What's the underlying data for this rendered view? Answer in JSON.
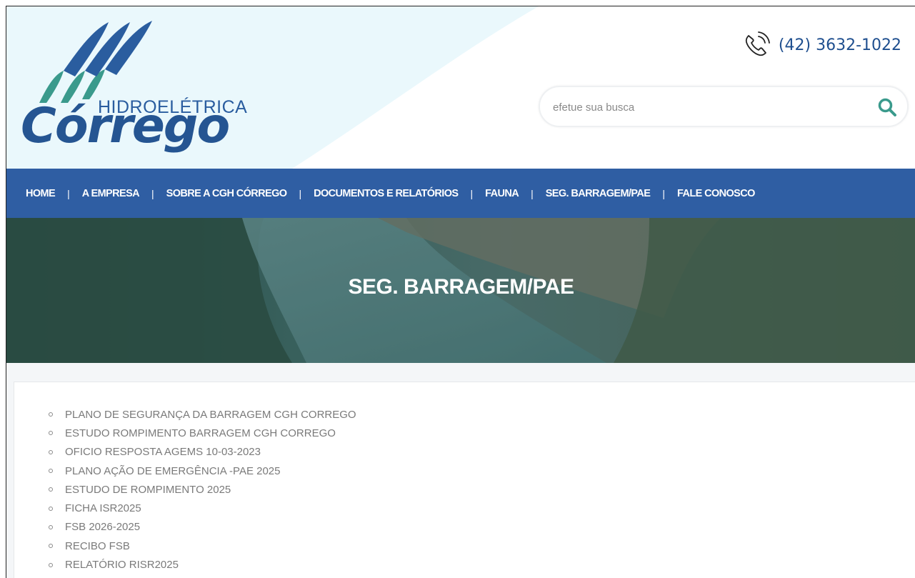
{
  "brand": {
    "subtitle": "HIDROELÉTRICA",
    "name": "Córrego"
  },
  "contact": {
    "phone": "(42) 3632-1022"
  },
  "search": {
    "placeholder": "efetue sua busca"
  },
  "nav": {
    "items": [
      {
        "label": "HOME"
      },
      {
        "label": "A EMPRESA"
      },
      {
        "label": "SOBRE A CGH CÓRREGO"
      },
      {
        "label": "DOCUMENTOS E RELATÓRIOS"
      },
      {
        "label": "FAUNA"
      },
      {
        "label": "SEG. BARRAGEM/PAE"
      },
      {
        "label": "FALE CONOSCO"
      }
    ],
    "separator": "|"
  },
  "banner": {
    "title": "SEG. BARRAGEM/PAE"
  },
  "documents": [
    {
      "label": "PLANO DE SEGURANÇA DA BARRAGEM CGH CORREGO"
    },
    {
      "label": "ESTUDO ROMPIMENTO BARRAGEM CGH CORREGO"
    },
    {
      "label": "OFICIO RESPOSTA AGEMS 10-03-2023"
    },
    {
      "label": "PLANO AÇÃO DE EMERGÊNCIA -PAE 2025"
    },
    {
      "label": "ESTUDO DE ROMPIMENTO 2025"
    },
    {
      "label": "FICHA ISR2025"
    },
    {
      "label": "FSB 2026-2025"
    },
    {
      "label": "RECIBO FSB"
    },
    {
      "label": "RELATÓRIO RISR2025"
    }
  ],
  "colors": {
    "nav_bg": "#2f5ea3",
    "brand_blue": "#255592",
    "brand_teal": "#3a9a8c",
    "header_tint": "#e9f7fb",
    "search_icon": "#3a9a8c"
  },
  "icons": {
    "phone": "phone-icon",
    "search": "search-icon"
  }
}
